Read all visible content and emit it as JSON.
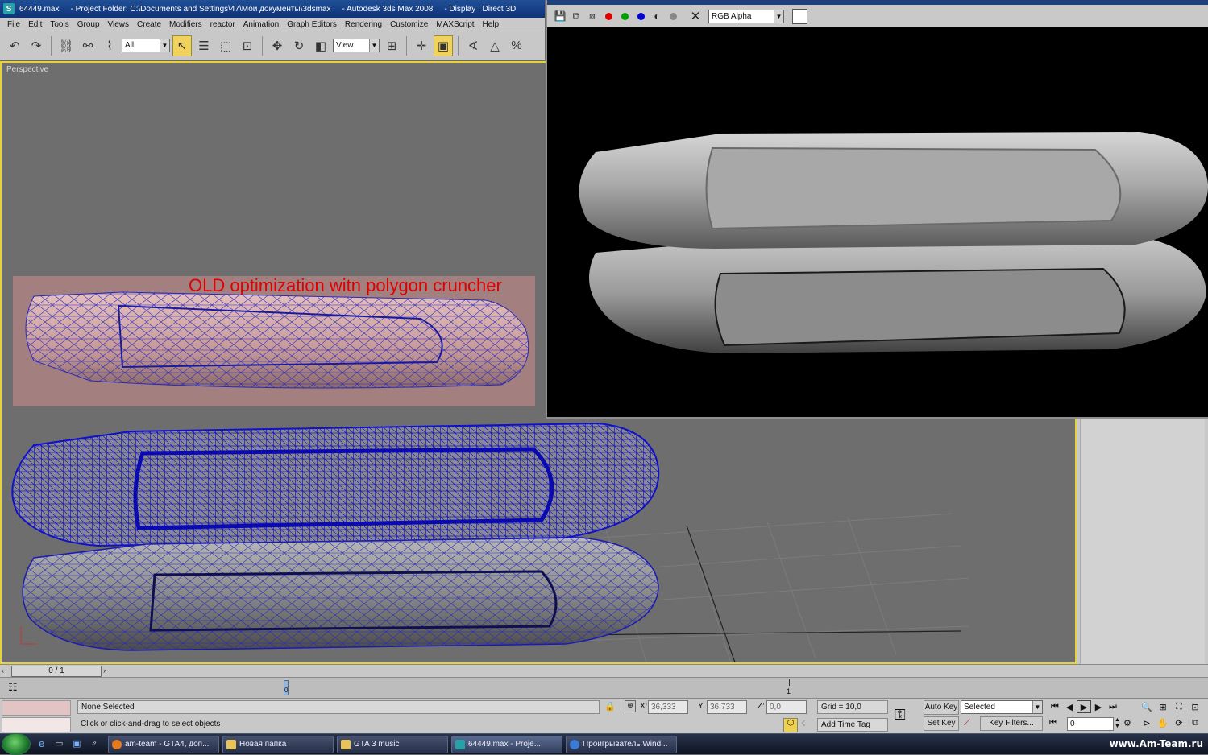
{
  "window": {
    "file": "64449.max",
    "project": "- Project Folder: C:\\Documents and Settings\\47\\Мои документы\\3dsmax",
    "app": "- Autodesk 3ds Max 2008",
    "display": "- Display : Direct 3D"
  },
  "menu": [
    "File",
    "Edit",
    "Tools",
    "Group",
    "Views",
    "Create",
    "Modifiers",
    "reactor",
    "Animation",
    "Graph Editors",
    "Rendering",
    "Customize",
    "MAXScript",
    "Help"
  ],
  "toolbar": {
    "selection_filter": "All",
    "reference_coord": "View"
  },
  "viewport": {
    "label": "Perspective",
    "annotation": "OLD optimization witn polygon cruncher"
  },
  "render_frame": {
    "channel": "RGB Alpha",
    "colors": {
      "red": "#e00000",
      "green": "#00a000",
      "blue": "#0000d0"
    }
  },
  "timeslider": {
    "frame": "0 / 1",
    "track_zero": "0",
    "track_one": "1"
  },
  "status": {
    "selection": "None Selected",
    "prompt": "Click or click-and-drag to select objects",
    "x_label": "X:",
    "x": "36,333",
    "y_label": "Y:",
    "y": "36,733",
    "z_label": "Z:",
    "z": "0,0",
    "grid": "Grid = 10,0",
    "add_time_tag": "Add Time Tag",
    "auto_key": "Auto Key",
    "set_key": "Set Key",
    "key_mode": "Selected",
    "key_filters": "Key Filters...",
    "current_frame": "0"
  },
  "taskbar": {
    "tasks": [
      "am-team - GTA4, доп...",
      "Новая папка",
      "GTA 3 music",
      "64449.max     - Proje...",
      "Проигрыватель Wind..."
    ],
    "watermark": "www.Am-Team.ru"
  }
}
